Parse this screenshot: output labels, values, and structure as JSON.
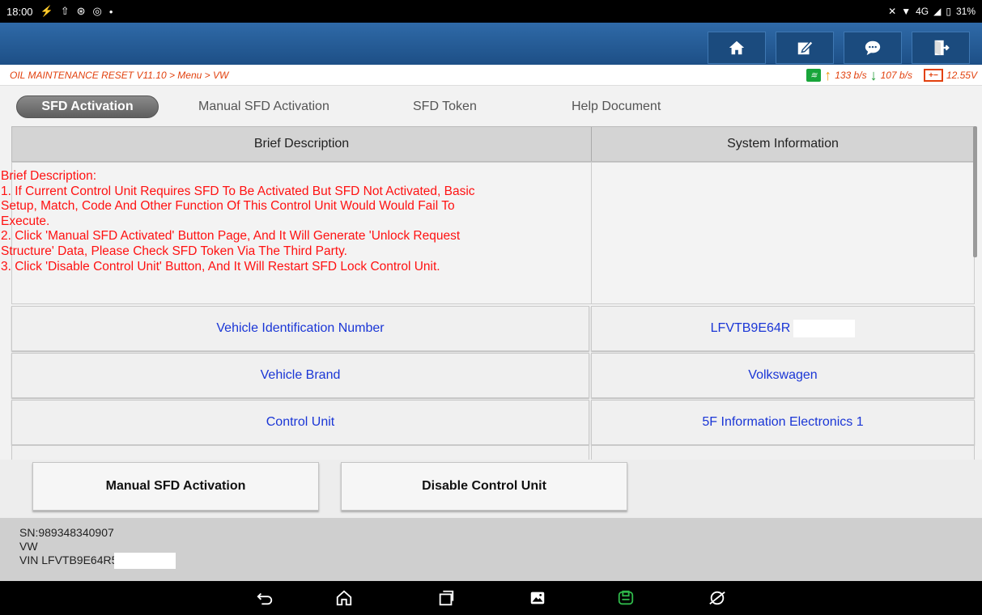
{
  "status_bar": {
    "time": "18:00",
    "left_icons": [
      "usb-icon",
      "upload-icon",
      "settings-icon",
      "whatsapp-icon"
    ],
    "dot": "•",
    "network": "4G",
    "battery": "31%"
  },
  "toolbar": {
    "buttons": [
      "home-icon",
      "edit-icon",
      "chat-icon",
      "exit-icon"
    ]
  },
  "breadcrumb": {
    "path": "OIL MAINTENANCE RESET V11.10 > Menu > VW",
    "upload_speed": "133 b/s",
    "download_speed": "107 b/s",
    "voltage": "12.55V"
  },
  "tabs": [
    {
      "label": "SFD Activation",
      "active": true
    },
    {
      "label": "Manual SFD Activation",
      "active": false
    },
    {
      "label": "SFD Token",
      "active": false
    },
    {
      "label": "Help Document",
      "active": false
    }
  ],
  "table": {
    "headers": [
      "Brief Description",
      "System Information"
    ],
    "description_lines": [
      "Brief Description:",
      "  1. If Current Control Unit Requires SFD To Be Activated But SFD Not Activated, Basic",
      "Setup, Match, Code And Other Function Of This Control Unit Would Would Fail To",
      "Execute.",
      "  2. Click 'Manual SFD Activated' Button Page, And It Will Generate 'Unlock Request",
      "Structure' Data, Please Check SFD Token Via The Third Party.",
      "  3. Click 'Disable Control Unit' Button, And It Will Restart SFD Lock Control Unit."
    ],
    "rows": [
      {
        "label": "Vehicle Identification Number",
        "value": "LFVTB9E64R"
      },
      {
        "label": "Vehicle Brand",
        "value": "Volkswagen"
      },
      {
        "label": "Control Unit",
        "value": "5F Information Electronics 1"
      }
    ]
  },
  "actions": {
    "manual_sfd": "Manual SFD Activation",
    "disable_unit": "Disable Control Unit"
  },
  "footer": {
    "sn": "SN:989348340907",
    "make": "VW",
    "vin": "VIN LFVTB9E64R5"
  },
  "nav_bar": [
    "back-icon",
    "home-icon",
    "recents-icon",
    "gallery-icon",
    "vci-icon",
    "browser-icon"
  ]
}
